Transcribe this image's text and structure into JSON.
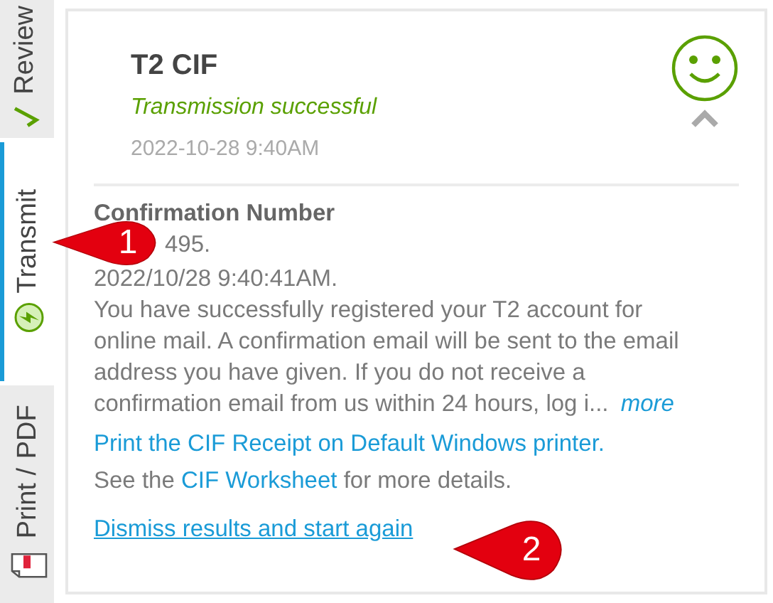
{
  "sidebar": {
    "tabs": [
      {
        "kind": "review",
        "label_parts": [
          "Review"
        ],
        "selected": false
      },
      {
        "kind": "transmit",
        "label_parts": [
          "Transmit"
        ],
        "selected": true
      },
      {
        "kind": "print",
        "label_parts": [
          "Print /",
          "PDF"
        ],
        "selected": false
      }
    ]
  },
  "result": {
    "title": "T2 CIF",
    "status": "Transmission successful",
    "date": "2022-10-28 9:40AM",
    "expanded": true,
    "confirmation_heading": "Confirmation Number",
    "confirmation_number": "495.",
    "confirmation_time": "2022/10/28 9:40:41AM.",
    "message": "You have successfully registered your T2 account for online mail. A confirmation email will be sent to the email address you have given. If you do not receive a confirmation email from us within 24 hours, log i...",
    "more_link": "more",
    "print_link": "Print the CIF Receipt on Default Windows printer.",
    "worksheet": {
      "before": "See the",
      "link": "CIF Worksheet",
      "after": "for more details."
    },
    "dismiss_link": "Dismiss results and start again"
  },
  "callouts": [
    "1",
    "2"
  ]
}
